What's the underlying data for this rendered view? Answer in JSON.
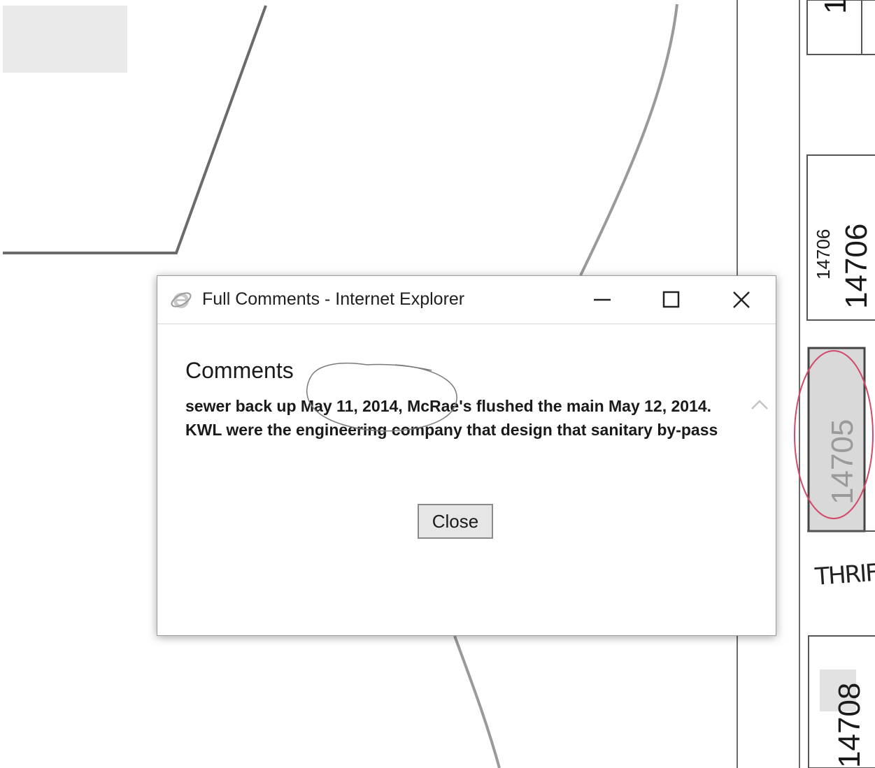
{
  "map": {
    "parcel_labels": {
      "p14706_small": "14706",
      "p14706_large": "14706",
      "p14705": "14705",
      "p14708": "14708",
      "p_top": "1"
    },
    "handwriting": "THRIF"
  },
  "dialog": {
    "title": "Full Comments - Internet Explorer",
    "icon": "internet-explorer-icon",
    "controls": {
      "minimize": "minimize-icon",
      "maximize": "maximize-icon",
      "close": "close-icon"
    },
    "heading": "Comments",
    "comment_text": "sewer back up May 11, 2014, McRae's flushed the main May 12, 2014. KWL were the engineering company that design that sanitary by-pass",
    "close_button_label": "Close"
  },
  "colors": {
    "map_line": "#6b6b6b",
    "annotation_pen": "#d24a6a",
    "highlight_fill": "#d9d9d9",
    "dialog_border": "#9c9c9c"
  }
}
